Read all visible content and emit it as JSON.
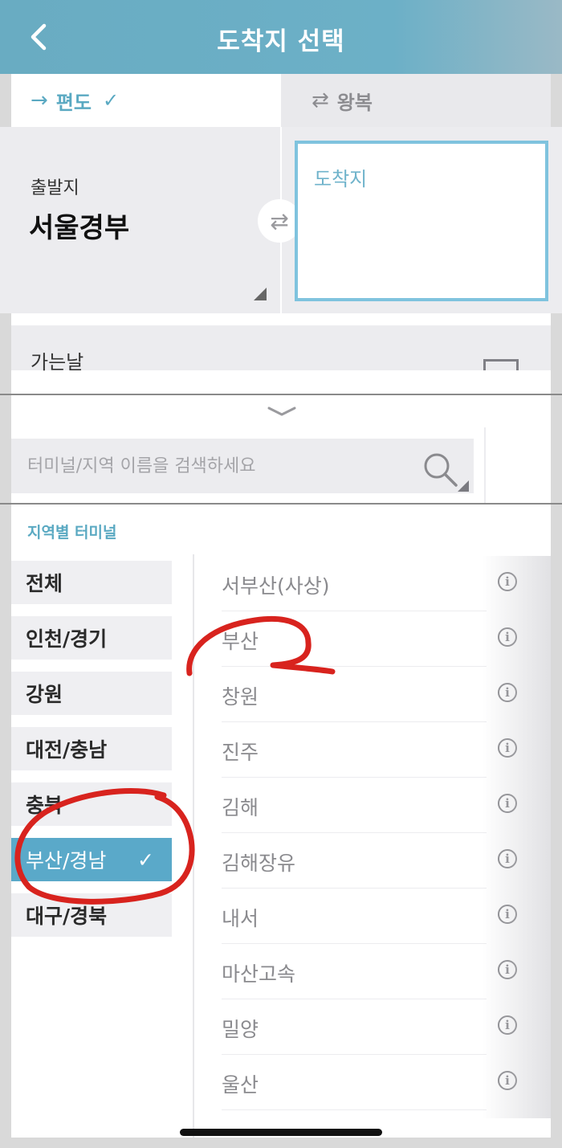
{
  "header": {
    "title": "도착지 선택",
    "back_icon": "chevron-left-icon"
  },
  "tabs": {
    "oneway": {
      "arrow": "→",
      "label": "편도",
      "check": "✓"
    },
    "round": {
      "arrow": "⇄",
      "label": "왕복"
    }
  },
  "route": {
    "departure_label": "출발지",
    "departure_value": "서울경부",
    "swap_symbol": "⇄",
    "arrival_placeholder": "도착지"
  },
  "date": {
    "label": "가는날"
  },
  "search": {
    "placeholder": "터미널/지역 이름을 검색하세요"
  },
  "section": {
    "label": "지역별 터미널"
  },
  "regions": [
    {
      "label": "전체",
      "selected": false
    },
    {
      "label": "인천/경기",
      "selected": false
    },
    {
      "label": "강원",
      "selected": false
    },
    {
      "label": "대전/충남",
      "selected": false
    },
    {
      "label": "충북",
      "selected": false
    },
    {
      "label": "부산/경남",
      "selected": true,
      "check": "✓"
    },
    {
      "label": "대구/경북",
      "selected": false
    }
  ],
  "terminals": [
    {
      "name": "서부산(사상)",
      "info": "i"
    },
    {
      "name": "부산",
      "info": "i"
    },
    {
      "name": "창원",
      "info": "i"
    },
    {
      "name": "진주",
      "info": "i"
    },
    {
      "name": "김해",
      "info": "i"
    },
    {
      "name": "김해장유",
      "info": "i"
    },
    {
      "name": "내서",
      "info": "i"
    },
    {
      "name": "마산고속",
      "info": "i"
    },
    {
      "name": "밀양",
      "info": "i"
    },
    {
      "name": "울산",
      "info": "i"
    }
  ],
  "colors": {
    "header": "#6cb0c7",
    "accent": "#5aa9c2",
    "annotation": "#d8231e"
  }
}
